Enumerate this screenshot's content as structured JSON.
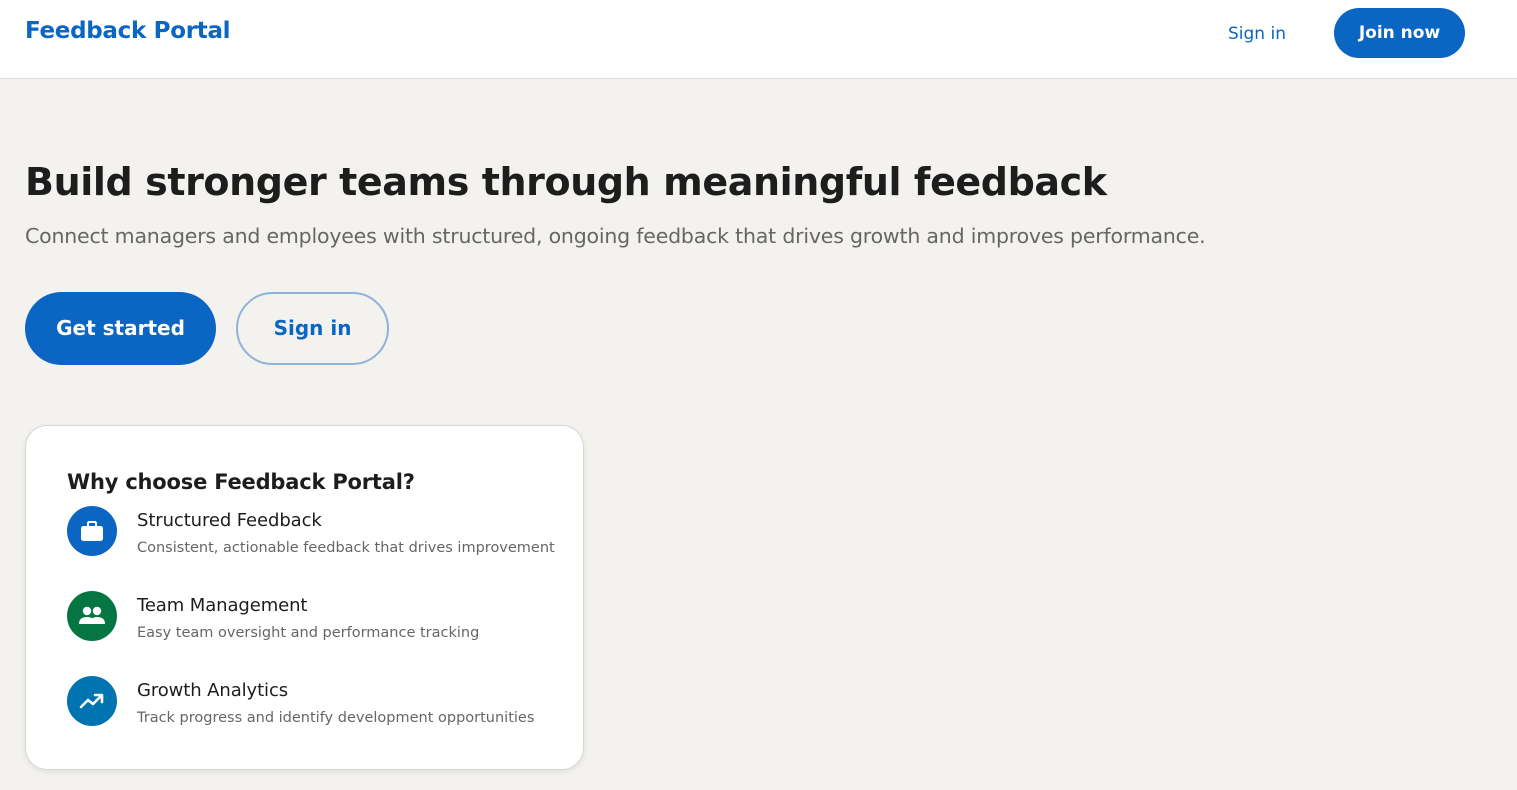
{
  "header": {
    "brand": "Feedback Portal",
    "sign_in": "Sign in",
    "join_now": "Join now"
  },
  "hero": {
    "title": "Build stronger teams through meaningful feedback",
    "subtitle": "Connect managers and employees with structured, ongoing feedback that drives growth and improves performance.",
    "primary_button": "Get started",
    "secondary_button": "Sign in"
  },
  "card": {
    "title": "Why choose Feedback Portal?",
    "features": [
      {
        "name": "Structured Feedback",
        "description": "Consistent, actionable feedback that drives improvement",
        "icon": "briefcase-icon",
        "color": "#0a66c2"
      },
      {
        "name": "Team Management",
        "description": "Easy team oversight and performance tracking",
        "icon": "people-icon",
        "color": "#057642"
      },
      {
        "name": "Growth Analytics",
        "description": "Track progress and identify development opportunities",
        "icon": "trending-up-icon",
        "color": "#0073b1"
      }
    ]
  },
  "colors": {
    "brand": "#0a66c2",
    "background": "#f3f2ef"
  }
}
